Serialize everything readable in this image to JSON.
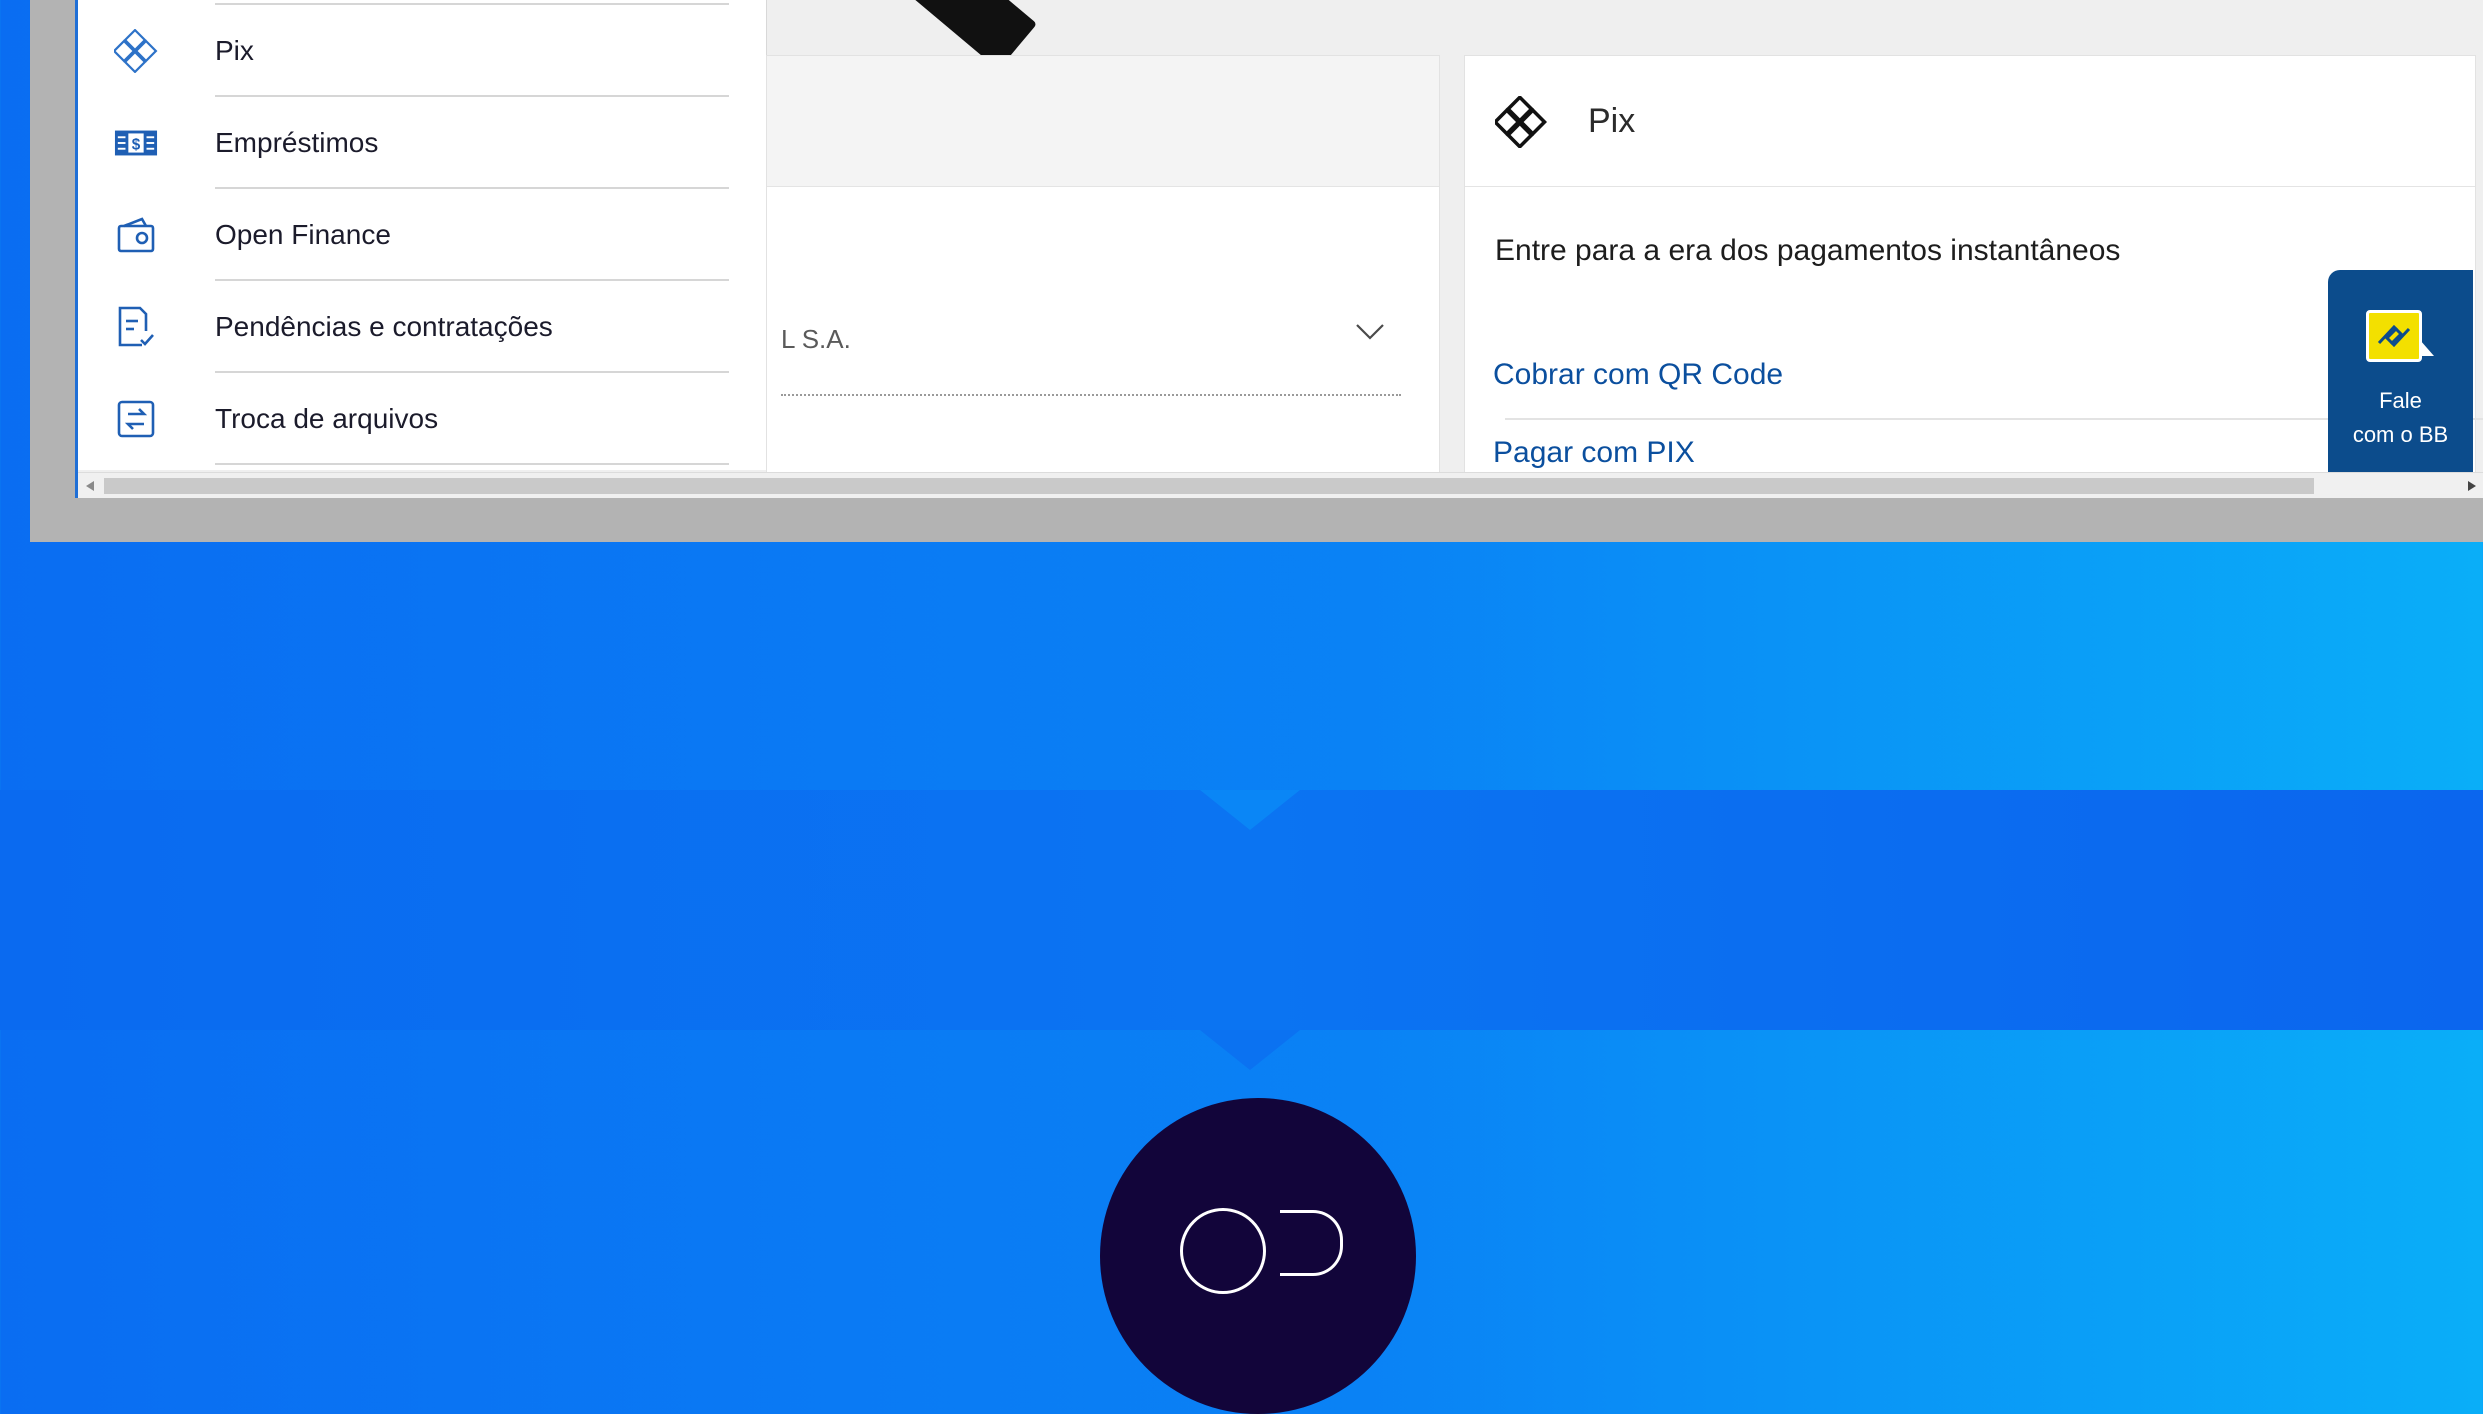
{
  "menu": {
    "items": [
      {
        "label": "Pix",
        "icon": "pix-icon"
      },
      {
        "label": "Empréstimos",
        "icon": "loan-icon"
      },
      {
        "label": "Open Finance",
        "icon": "wallet-icon"
      },
      {
        "label": "Pendências e contratações",
        "icon": "document-check-icon"
      },
      {
        "label": "Troca de arquivos",
        "icon": "file-exchange-icon"
      }
    ]
  },
  "account_card": {
    "selected_value": "L S.A."
  },
  "pix_card": {
    "title": "Pix",
    "description": "Entre para a era dos pagamentos instantâneos",
    "links": [
      "Cobrar com QR Code",
      "Pagar com PIX"
    ]
  },
  "chat_button": {
    "line1": "Fale",
    "line2": "com o BB"
  },
  "colors": {
    "brand_blue": "#0c4c8c",
    "link_blue": "#0b4f9e",
    "bb_yellow": "#f3e000",
    "background_blue": "#0a82f5",
    "circle_dark": "#12053a"
  }
}
